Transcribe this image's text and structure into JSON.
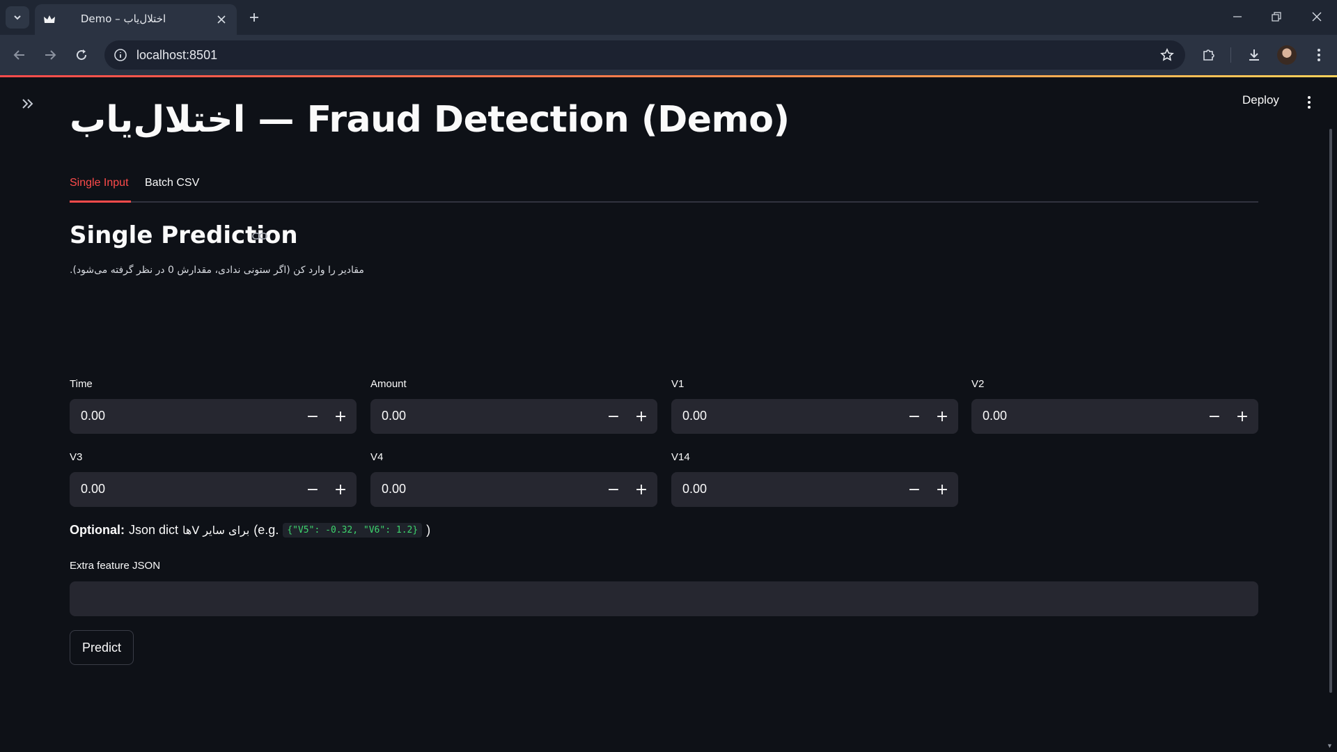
{
  "browser": {
    "tab_title": "Demo – اختلال‌یاب",
    "url": "localhost:8501"
  },
  "app": {
    "deploy_label": "Deploy",
    "page_title": "اختلال‌یاب — Fraud Detection (Demo)",
    "tabs": [
      {
        "label": "Single Input",
        "active": true
      },
      {
        "label": "Batch CSV",
        "active": false
      }
    ],
    "section_title": "Single Prediction",
    "caption": "مقادیر را وارد کن (اگر ستونی ندادی، مقدارش 0 در نظر گرفته می‌شود).",
    "fields": [
      {
        "label": "Time",
        "value": "0.00"
      },
      {
        "label": "Amount",
        "value": "0.00"
      },
      {
        "label": "V1",
        "value": "0.00"
      },
      {
        "label": "V2",
        "value": "0.00"
      },
      {
        "label": "V3",
        "value": "0.00"
      },
      {
        "label": "V4",
        "value": "0.00"
      },
      {
        "label": "V14",
        "value": "0.00"
      }
    ],
    "optional": {
      "bold": "Optional:",
      "text_before": "Json dict",
      "text_rtl": "برای سایر Vها",
      "text_eg": "(e.g.",
      "code": "{\"V5\": -0.32, \"V6\": 1.2}",
      "text_after": ")"
    },
    "extra_json_label": "Extra feature JSON",
    "extra_json_value": "",
    "predict_label": "Predict",
    "step_minus": "−",
    "step_plus": "+"
  },
  "colors": {
    "accent": "#ff4b4b",
    "background": "#0e1117",
    "input_bg": "#262730",
    "code_green": "#3dd56d"
  }
}
